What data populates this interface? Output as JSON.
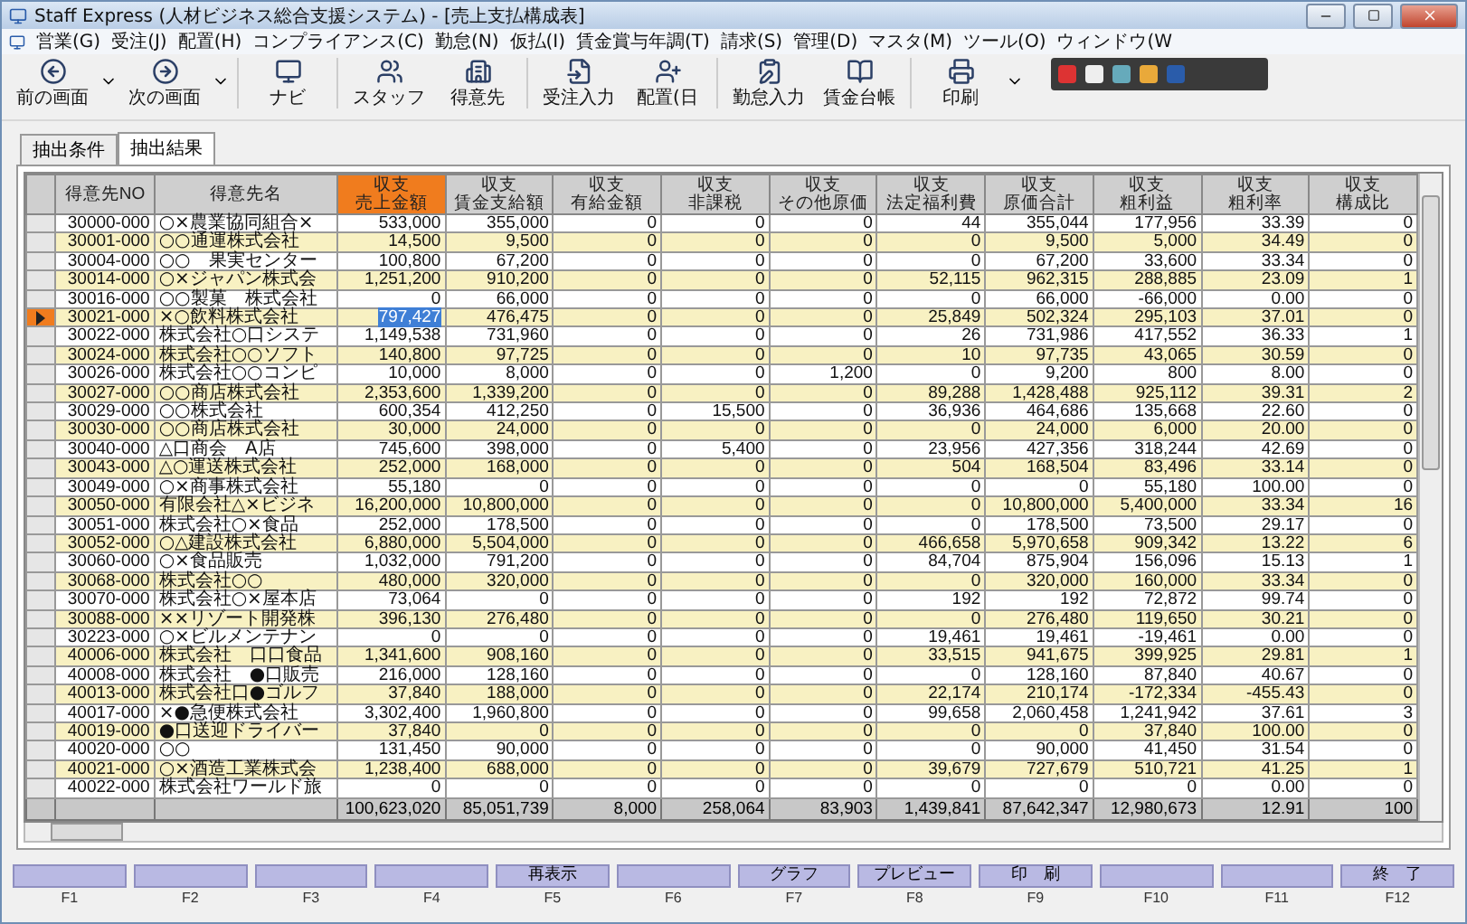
{
  "window": {
    "title": "Staff Express (人材ビジネス総合支援システム) - [売上支払構成表]"
  },
  "menu": [
    "営業(G)",
    "受注(J)",
    "配置(H)",
    "コンプライアンス(C)",
    "勤怠(N)",
    "仮払(I)",
    "賃金賞与年調(T)",
    "請求(S)",
    "管理(D)",
    "マスタ(M)",
    "ツール(O)",
    "ウィンドウ(W"
  ],
  "toolbar": [
    {
      "label": "前の画面",
      "kind": "back",
      "dropdown": true
    },
    {
      "label": "次の画面",
      "kind": "forward",
      "dropdown": true
    },
    {
      "label": "ナビ",
      "kind": "navi",
      "dropdown": false
    },
    {
      "label": "スタッフ",
      "kind": "staff",
      "dropdown": false
    },
    {
      "label": "得意先",
      "kind": "client",
      "dropdown": false
    },
    {
      "label": "受注入力",
      "kind": "order",
      "dropdown": false
    },
    {
      "label": "配置(日",
      "kind": "assign",
      "dropdown": false
    },
    {
      "label": "勤怠入力",
      "kind": "attendance",
      "dropdown": false
    },
    {
      "label": "賃金台帳",
      "kind": "ledger",
      "dropdown": false
    },
    {
      "label": "印刷",
      "kind": "print",
      "dropdown": true
    }
  ],
  "tabs": [
    {
      "label": "抽出条件",
      "selected": false
    },
    {
      "label": "抽出結果",
      "selected": true
    }
  ],
  "table": {
    "columns": [
      {
        "label": "得意先NO",
        "selected": false
      },
      {
        "label": "得意先名",
        "selected": false
      },
      {
        "group": "収支",
        "label": "売上金額",
        "selected": true
      },
      {
        "group": "収支",
        "label": "賃金支給額",
        "selected": false
      },
      {
        "group": "収支",
        "label": "有給金額",
        "selected": false
      },
      {
        "group": "収支",
        "label": "非課税",
        "selected": false
      },
      {
        "group": "収支",
        "label": "その他原価",
        "selected": false
      },
      {
        "group": "収支",
        "label": "法定福利費",
        "selected": false
      },
      {
        "group": "収支",
        "label": "原価合計",
        "selected": false
      },
      {
        "group": "収支",
        "label": "粗利益",
        "selected": false
      },
      {
        "group": "収支",
        "label": "粗利率",
        "selected": false
      },
      {
        "group": "収支",
        "label": "構成比",
        "selected": false
      }
    ],
    "rows": [
      {
        "selected": false,
        "cells": [
          "30000-000",
          "○×農業協同組合×",
          "533,000",
          "355,000",
          "0",
          "0",
          "0",
          "44",
          "355,044",
          "177,956",
          "33.39",
          "0"
        ]
      },
      {
        "selected": false,
        "cells": [
          "30001-000",
          "○○通運株式会社",
          "14,500",
          "9,500",
          "0",
          "0",
          "0",
          "0",
          "9,500",
          "5,000",
          "34.49",
          "0"
        ]
      },
      {
        "selected": false,
        "cells": [
          "30004-000",
          "○○　果実センター",
          "100,800",
          "67,200",
          "0",
          "0",
          "0",
          "0",
          "67,200",
          "33,600",
          "33.34",
          "0"
        ]
      },
      {
        "selected": false,
        "cells": [
          "30014-000",
          "○×ジャパン株式会",
          "1,251,200",
          "910,200",
          "0",
          "0",
          "0",
          "52,115",
          "962,315",
          "288,885",
          "23.09",
          "1"
        ]
      },
      {
        "selected": false,
        "cells": [
          "30016-000",
          "○○製菓　株式会社",
          "0",
          "66,000",
          "0",
          "0",
          "0",
          "0",
          "66,000",
          "-66,000",
          "0.00",
          "0"
        ]
      },
      {
        "selected": true,
        "cells": [
          "30021-000",
          "×○飲料株式会社",
          "797,427",
          "476,475",
          "0",
          "0",
          "0",
          "25,849",
          "502,324",
          "295,103",
          "37.01",
          "0"
        ]
      },
      {
        "selected": false,
        "cells": [
          "30022-000",
          "株式会社○口システ",
          "1,149,538",
          "731,960",
          "0",
          "0",
          "0",
          "26",
          "731,986",
          "417,552",
          "36.33",
          "1"
        ]
      },
      {
        "selected": false,
        "cells": [
          "30024-000",
          "株式会社○○ソフト",
          "140,800",
          "97,725",
          "0",
          "0",
          "0",
          "10",
          "97,735",
          "43,065",
          "30.59",
          "0"
        ]
      },
      {
        "selected": false,
        "cells": [
          "30026-000",
          "株式会社○○コンピ",
          "10,000",
          "8,000",
          "0",
          "0",
          "1,200",
          "0",
          "9,200",
          "800",
          "8.00",
          "0"
        ]
      },
      {
        "selected": false,
        "cells": [
          "30027-000",
          "○○商店株式会社",
          "2,353,600",
          "1,339,200",
          "0",
          "0",
          "0",
          "89,288",
          "1,428,488",
          "925,112",
          "39.31",
          "2"
        ]
      },
      {
        "selected": false,
        "cells": [
          "30029-000",
          "○○株式会社",
          "600,354",
          "412,250",
          "0",
          "15,500",
          "0",
          "36,936",
          "464,686",
          "135,668",
          "22.60",
          "0"
        ]
      },
      {
        "selected": false,
        "cells": [
          "30030-000",
          "○○商店株式会社",
          "30,000",
          "24,000",
          "0",
          "0",
          "0",
          "0",
          "24,000",
          "6,000",
          "20.00",
          "0"
        ]
      },
      {
        "selected": false,
        "cells": [
          "30040-000",
          "△口商会　A店",
          "745,600",
          "398,000",
          "0",
          "5,400",
          "0",
          "23,956",
          "427,356",
          "318,244",
          "42.69",
          "0"
        ]
      },
      {
        "selected": false,
        "cells": [
          "30043-000",
          "△○運送株式会社",
          "252,000",
          "168,000",
          "0",
          "0",
          "0",
          "504",
          "168,504",
          "83,496",
          "33.14",
          "0"
        ]
      },
      {
        "selected": false,
        "cells": [
          "30049-000",
          "○×商事株式会社",
          "55,180",
          "0",
          "0",
          "0",
          "0",
          "0",
          "0",
          "55,180",
          "100.00",
          "0"
        ]
      },
      {
        "selected": false,
        "cells": [
          "30050-000",
          "有限会社△×ビジネ",
          "16,200,000",
          "10,800,000",
          "0",
          "0",
          "0",
          "0",
          "10,800,000",
          "5,400,000",
          "33.34",
          "16"
        ]
      },
      {
        "selected": false,
        "cells": [
          "30051-000",
          "株式会社○×食品",
          "252,000",
          "178,500",
          "0",
          "0",
          "0",
          "0",
          "178,500",
          "73,500",
          "29.17",
          "0"
        ]
      },
      {
        "selected": false,
        "cells": [
          "30052-000",
          "○△建設株式会社",
          "6,880,000",
          "5,504,000",
          "0",
          "0",
          "0",
          "466,658",
          "5,970,658",
          "909,342",
          "13.22",
          "6"
        ]
      },
      {
        "selected": false,
        "cells": [
          "30060-000",
          "○×食品販売",
          "1,032,000",
          "791,200",
          "0",
          "0",
          "0",
          "84,704",
          "875,904",
          "156,096",
          "15.13",
          "1"
        ]
      },
      {
        "selected": false,
        "cells": [
          "30068-000",
          "株式会社○○",
          "480,000",
          "320,000",
          "0",
          "0",
          "0",
          "0",
          "320,000",
          "160,000",
          "33.34",
          "0"
        ]
      },
      {
        "selected": false,
        "cells": [
          "30070-000",
          "株式会社○×屋本店",
          "73,064",
          "0",
          "0",
          "0",
          "0",
          "192",
          "192",
          "72,872",
          "99.74",
          "0"
        ]
      },
      {
        "selected": false,
        "cells": [
          "30088-000",
          "××リゾート開発株",
          "396,130",
          "276,480",
          "0",
          "0",
          "0",
          "0",
          "276,480",
          "119,650",
          "30.21",
          "0"
        ]
      },
      {
        "selected": false,
        "cells": [
          "30223-000",
          "○×ビルメンテナン",
          "0",
          "0",
          "0",
          "0",
          "0",
          "19,461",
          "19,461",
          "-19,461",
          "0.00",
          "0"
        ]
      },
      {
        "selected": false,
        "cells": [
          "40006-000",
          "株式会社　口口食品",
          "1,341,600",
          "908,160",
          "0",
          "0",
          "0",
          "33,515",
          "941,675",
          "399,925",
          "29.81",
          "1"
        ]
      },
      {
        "selected": false,
        "cells": [
          "40008-000",
          "株式会社　●口販売",
          "216,000",
          "128,160",
          "0",
          "0",
          "0",
          "0",
          "128,160",
          "87,840",
          "40.67",
          "0"
        ]
      },
      {
        "selected": false,
        "cells": [
          "40013-000",
          "株式会社口●ゴルフ",
          "37,840",
          "188,000",
          "0",
          "0",
          "0",
          "22,174",
          "210,174",
          "-172,334",
          "-455.43",
          "0"
        ]
      },
      {
        "selected": false,
        "cells": [
          "40017-000",
          "×●急便株式会社",
          "3,302,400",
          "1,960,800",
          "0",
          "0",
          "0",
          "99,658",
          "2,060,458",
          "1,241,942",
          "37.61",
          "3"
        ]
      },
      {
        "selected": false,
        "cells": [
          "40019-000",
          "●口送迎ドライバー",
          "37,840",
          "0",
          "0",
          "0",
          "0",
          "0",
          "0",
          "37,840",
          "100.00",
          "0"
        ]
      },
      {
        "selected": false,
        "cells": [
          "40020-000",
          "○○",
          "131,450",
          "90,000",
          "0",
          "0",
          "0",
          "0",
          "90,000",
          "41,450",
          "31.54",
          "0"
        ]
      },
      {
        "selected": false,
        "cells": [
          "40021-000",
          "○×酒造工業株式会",
          "1,238,400",
          "688,000",
          "0",
          "0",
          "0",
          "39,679",
          "727,679",
          "510,721",
          "41.25",
          "1"
        ]
      },
      {
        "selected": false,
        "cells": [
          "40022-000",
          "株式会社ワールド旅",
          "0",
          "0",
          "0",
          "0",
          "0",
          "0",
          "0",
          "0",
          "0.00",
          "0"
        ]
      }
    ],
    "totals": [
      "100,623,020",
      "85,051,739",
      "8,000",
      "258,064",
      "83,903",
      "1,439,841",
      "87,642,347",
      "12,980,673",
      "12.91",
      "100"
    ]
  },
  "function_keys": [
    {
      "key": "F1"
    },
    {
      "key": "F2"
    },
    {
      "key": "F3"
    },
    {
      "key": "F4"
    },
    {
      "key": "F5",
      "label": "再表示"
    },
    {
      "key": "F6"
    },
    {
      "key": "F7",
      "label": "グラフ"
    },
    {
      "key": "F8",
      "label": "プレビュー"
    },
    {
      "key": "F9",
      "label": "印　刷"
    },
    {
      "key": "F10"
    },
    {
      "key": "F11"
    },
    {
      "key": "F12",
      "label": "終　了"
    }
  ]
}
